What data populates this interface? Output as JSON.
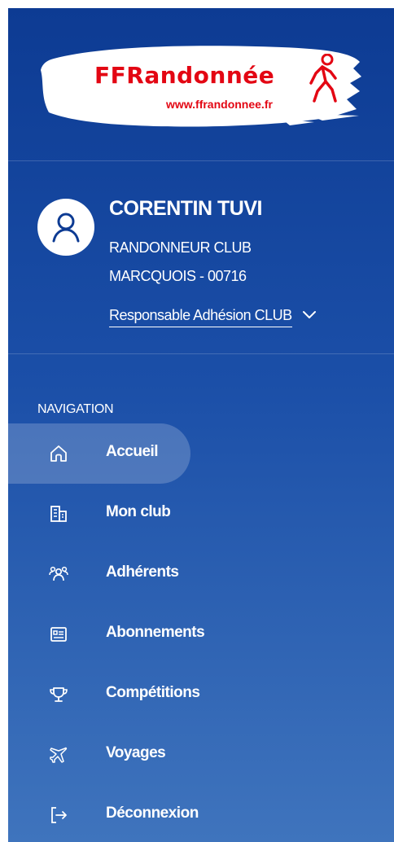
{
  "logo": {
    "brand": "FFRandonnée",
    "url": "www.ffrandonnee.fr",
    "color": "#e30613"
  },
  "profile": {
    "name": "CORENTIN TUVI",
    "club_line1": "RANDONNEUR CLUB",
    "club_line2": "MARCQUOIS - 00716",
    "role": "Responsable Adhésion CLUB"
  },
  "navigation": {
    "heading": "NAVIGATION",
    "items": [
      {
        "label": "Accueil",
        "icon": "home-icon",
        "active": true
      },
      {
        "label": "Mon club",
        "icon": "building-icon"
      },
      {
        "label": "Adhérents",
        "icon": "users-icon"
      },
      {
        "label": "Abonnements",
        "icon": "subscription-card-icon"
      },
      {
        "label": "Compétitions",
        "icon": "trophy-icon"
      },
      {
        "label": "Voyages",
        "icon": "airplane-icon"
      },
      {
        "label": "Déconnexion",
        "icon": "logout-icon"
      }
    ]
  },
  "colors": {
    "sidebar_top": "#0d3b93",
    "sidebar_bottom": "#3f74bd",
    "text": "#ffffff"
  }
}
